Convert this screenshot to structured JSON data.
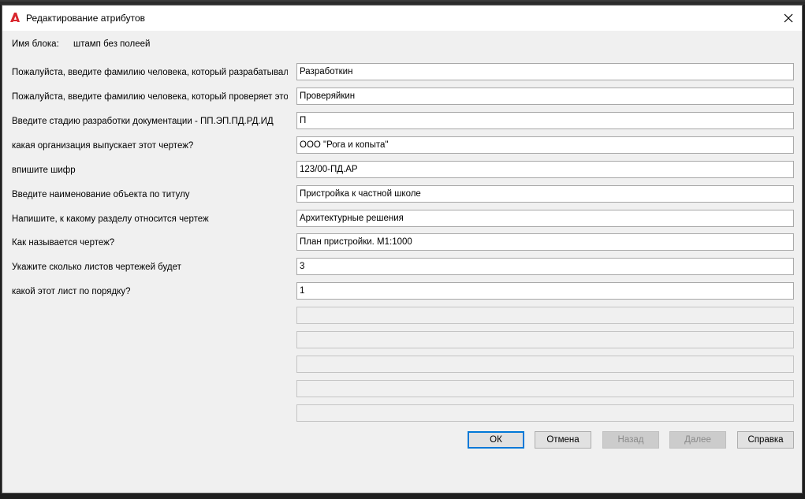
{
  "window": {
    "title": "Редактирование атрибутов",
    "close_symbol": "✕"
  },
  "block": {
    "label": "Имя блока:",
    "value": "штамп без полеей"
  },
  "fields": [
    {
      "label": "Пожалуйста, введите фамилию человека, который разрабатывал э",
      "value": "Разработкин"
    },
    {
      "label": "Пожалуйста, введите фамилию человека, который проверяет этот",
      "value": "Проверяйкин"
    },
    {
      "label": "Введите стадию разработки документации - ПП.ЭП.ПД.РД.ИД",
      "value": "П"
    },
    {
      "label": "какая организация выпускает этот чертеж?",
      "value": "ООО \"Рога и копыта\""
    },
    {
      "label": "впишите шифр",
      "value": "123/00-ПД.АР"
    },
    {
      "label": "Введите наименование объекта по титулу",
      "value": "Пристройка к частной школе"
    },
    {
      "label": "Напишите, к какому разделу относится чертеж",
      "value": "Архитектурные решения"
    },
    {
      "label": "Как называется чертеж?",
      "value": "План пристройки. М1:1000"
    },
    {
      "label": "Укажите сколько листов чертежей будет",
      "value": "3"
    },
    {
      "label": "какой этот лист по порядку?",
      "value": "1"
    }
  ],
  "buttons": {
    "ok": "ОК",
    "cancel": "Отмена",
    "back": "Назад",
    "next": "Далее",
    "help": "Справка"
  },
  "colors": {
    "app_icon_red": "#d9272e",
    "focus_blue": "#0078d7"
  },
  "icons": {
    "app": "autocad-logo-icon",
    "close": "close-icon"
  }
}
